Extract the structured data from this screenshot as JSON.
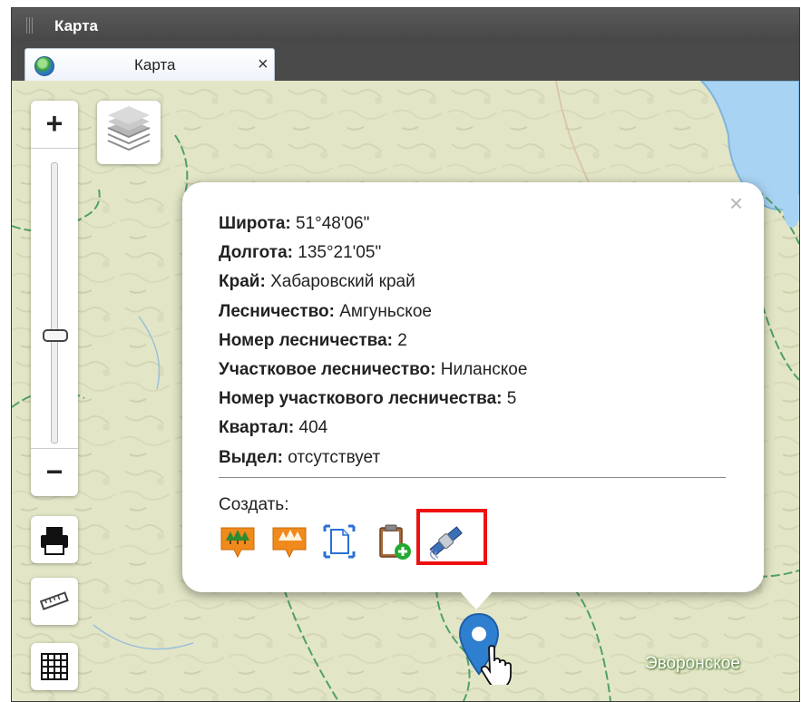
{
  "window": {
    "title": "Карта"
  },
  "tab": {
    "label": "Карта",
    "close": "×"
  },
  "map": {
    "zoom": {
      "in_label": "+",
      "out_label": "−",
      "level": 0.62
    },
    "place_label": "Эворонское"
  },
  "popup": {
    "close": "×",
    "fields": [
      {
        "label": "Широта:",
        "value": "51°48'06\""
      },
      {
        "label": "Долгота:",
        "value": "135°21'05\""
      },
      {
        "label": "Край:",
        "value": "Хабаровский край"
      },
      {
        "label": "Лесничество:",
        "value": "Амгуньское"
      },
      {
        "label": "Номер лесничества:",
        "value": "2"
      },
      {
        "label": "Участковое лесничество:",
        "value": "Ниланское"
      },
      {
        "label": "Номер участкового лесничества:",
        "value": "5"
      },
      {
        "label": "Квартал:",
        "value": "404"
      },
      {
        "label": "Выдел:",
        "value": "отсутствует"
      }
    ],
    "create_label": "Создать:",
    "tools": [
      "forest-plot-icon",
      "forest-plot-light-icon",
      "document-icon",
      "clipboard-add-icon",
      "satellite-icon"
    ]
  },
  "colors": {
    "highlight": "#ee1111",
    "water": "#a9d3f2",
    "land": "#e4e6c8",
    "border": "#4fa06a"
  }
}
